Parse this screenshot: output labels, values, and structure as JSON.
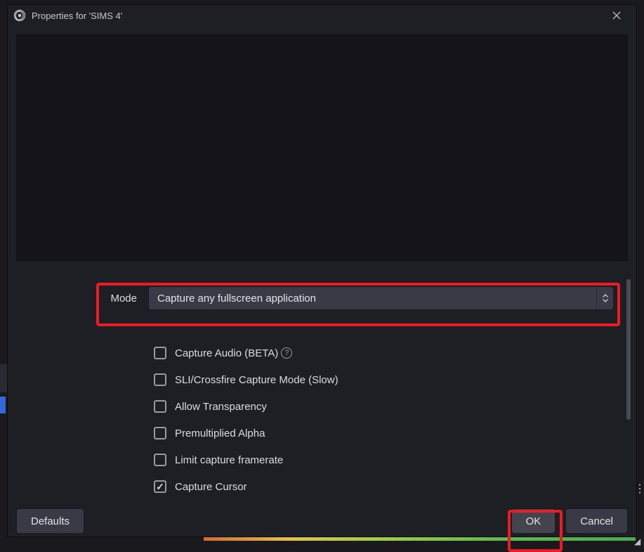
{
  "titlebar": {
    "text": "Properties for 'SIMS 4'"
  },
  "settings": {
    "mode_label": "Mode",
    "mode_value": "Capture any fullscreen application",
    "checkboxes": [
      {
        "label": "Capture Audio (BETA)",
        "checked": false,
        "help": true
      },
      {
        "label": "SLI/Crossfire Capture Mode (Slow)",
        "checked": false,
        "help": false
      },
      {
        "label": "Allow Transparency",
        "checked": false,
        "help": false
      },
      {
        "label": "Premultiplied Alpha",
        "checked": false,
        "help": false
      },
      {
        "label": "Limit capture framerate",
        "checked": false,
        "help": false
      },
      {
        "label": "Capture Cursor",
        "checked": true,
        "help": false
      }
    ]
  },
  "buttons": {
    "defaults": "Defaults",
    "ok": "OK",
    "cancel": "Cancel"
  },
  "colors": {
    "highlight": "#ed1c24",
    "dialog_bg": "#1e1e25",
    "control_bg": "#3a3a46"
  }
}
